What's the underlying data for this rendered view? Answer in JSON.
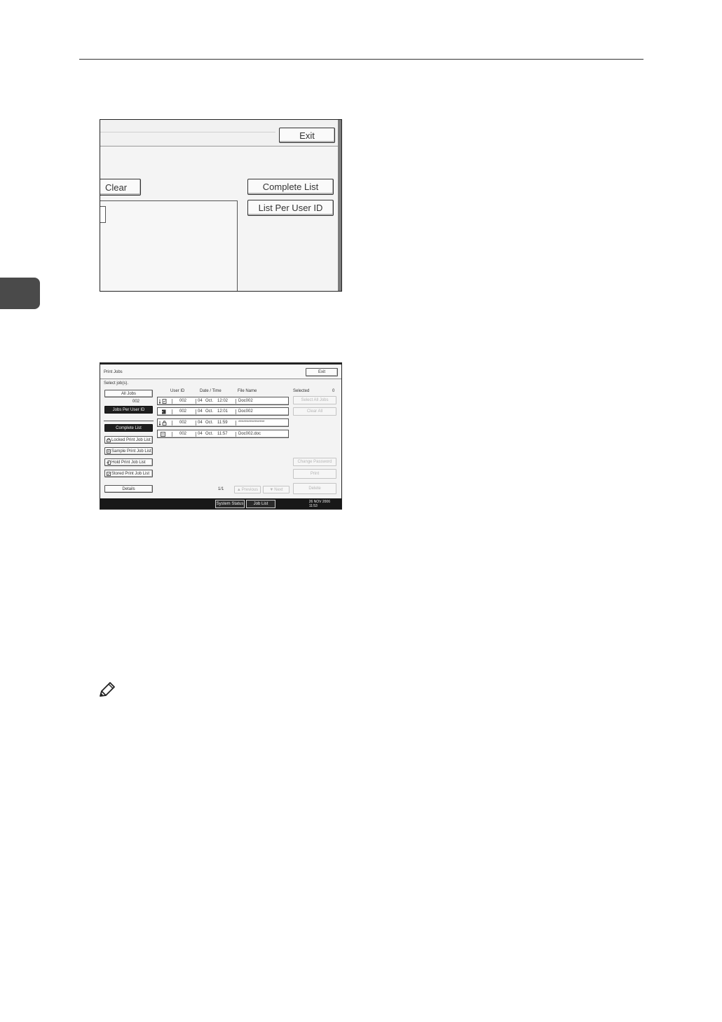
{
  "screen1": {
    "exit_label": "Exit",
    "clear_label": "Clear",
    "complete_list_label": "Complete List",
    "list_per_user_label": "List Per User ID"
  },
  "screen2": {
    "title": "Print Jobs",
    "exit_label": "Exit",
    "prompt": "Select job(s).",
    "all_jobs_label": "All Jobs",
    "user_id_value": "002",
    "jobs_per_user_label": "Jobs Per User ID",
    "complete_list_label": "Complete List",
    "locked_list_label": "Locked Print Job List",
    "sample_list_label": "Sample Print Job List",
    "hold_list_label": "Hold Print Job List",
    "stored_list_label": "Stored Print Job List",
    "details_label": "Details",
    "columns": {
      "user_id": "User ID",
      "date_time": "Date / Time",
      "file_name": "File Name"
    },
    "rows": [
      {
        "icon": "stored-print-icon",
        "user_id": "002",
        "day": "04",
        "month": "Oct.",
        "time": "12:02",
        "file": "Doc002"
      },
      {
        "icon": "hold-print-icon",
        "user_id": "002",
        "day": "04",
        "month": "Oct.",
        "time": "12:01",
        "file": "Doc002"
      },
      {
        "icon": "locked-print-icon",
        "user_id": "002",
        "day": "04",
        "month": "Oct.",
        "time": "11:59",
        "file": "****************"
      },
      {
        "icon": "sample-print-icon",
        "user_id": "002",
        "day": "04",
        "month": "Oct.",
        "time": "11:57",
        "file": "Doc002.doc"
      }
    ],
    "selected_label": "Selected",
    "selected_count": "0",
    "select_all_label": "Select All Jobs",
    "clear_all_label": "Clear All",
    "change_password_label": "Change Password",
    "print_label": "Print",
    "delete_label": "Delete",
    "page_indicator": "1/1",
    "previous_label": "Previous",
    "next_label": "Next",
    "status_tab_label": "System Status",
    "job_list_tab_label": "Job List",
    "date_label": "26 NOV 2006",
    "time_label": "11:53"
  }
}
